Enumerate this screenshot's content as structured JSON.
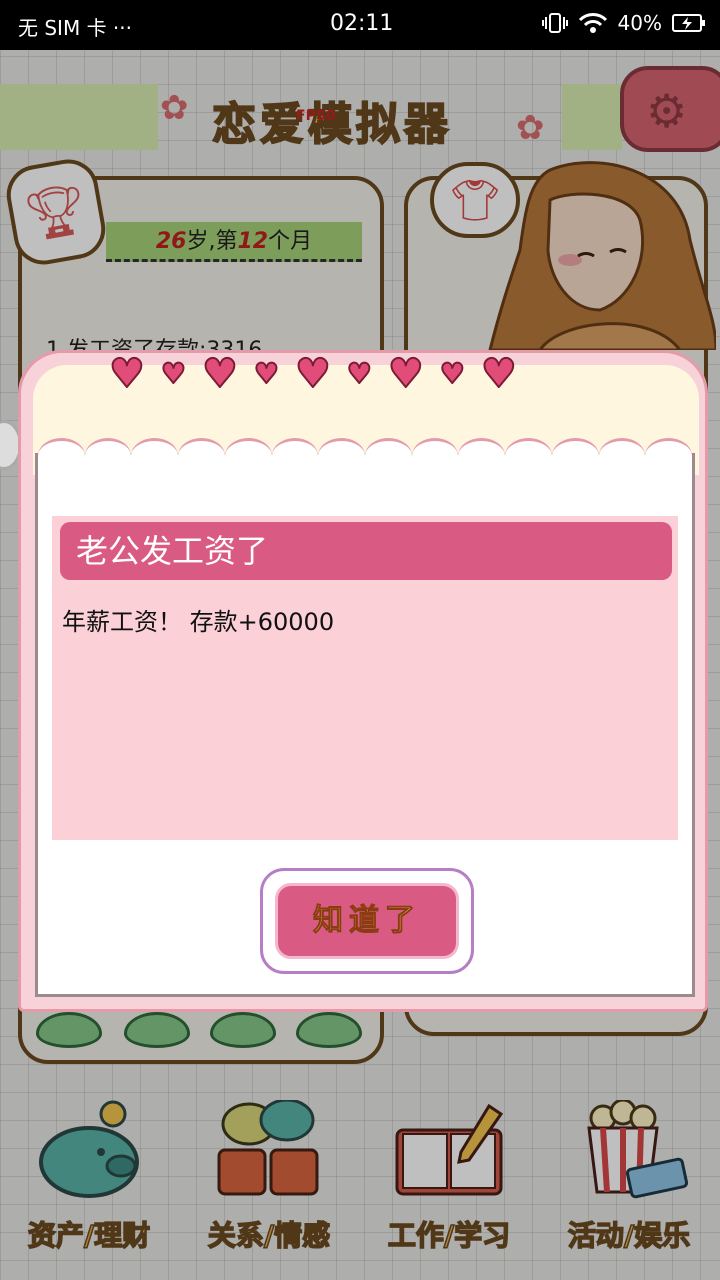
{
  "status_bar": {
    "carrier": "无 SIM 卡 ···",
    "time": "02:11",
    "battery": "40%"
  },
  "header": {
    "title": "恋爱模拟器",
    "fps": "FPS0",
    "settings_icon": "gear-icon"
  },
  "profile": {
    "age_num": "26",
    "age_unit": "岁,第",
    "month_num": "12",
    "month_unit": "个月",
    "info_line": "1.发工资了存款:3316"
  },
  "dialog": {
    "title": "老公发工资了",
    "message": "年薪工资！ 存款+60000",
    "ok_label": "知道了"
  },
  "nav": {
    "items": [
      {
        "label": "资产/理财",
        "icon": "piggy-bank-icon"
      },
      {
        "label": "关系/情感",
        "icon": "coffee-cups-icon"
      },
      {
        "label": "工作/学习",
        "icon": "book-pen-icon"
      },
      {
        "label": "活动/娱乐",
        "icon": "popcorn-ticket-icon"
      }
    ]
  },
  "colors": {
    "accent_pink": "#d95b84",
    "dialog_bg": "#f8d2d9",
    "title_gold": "#e8b24a"
  }
}
